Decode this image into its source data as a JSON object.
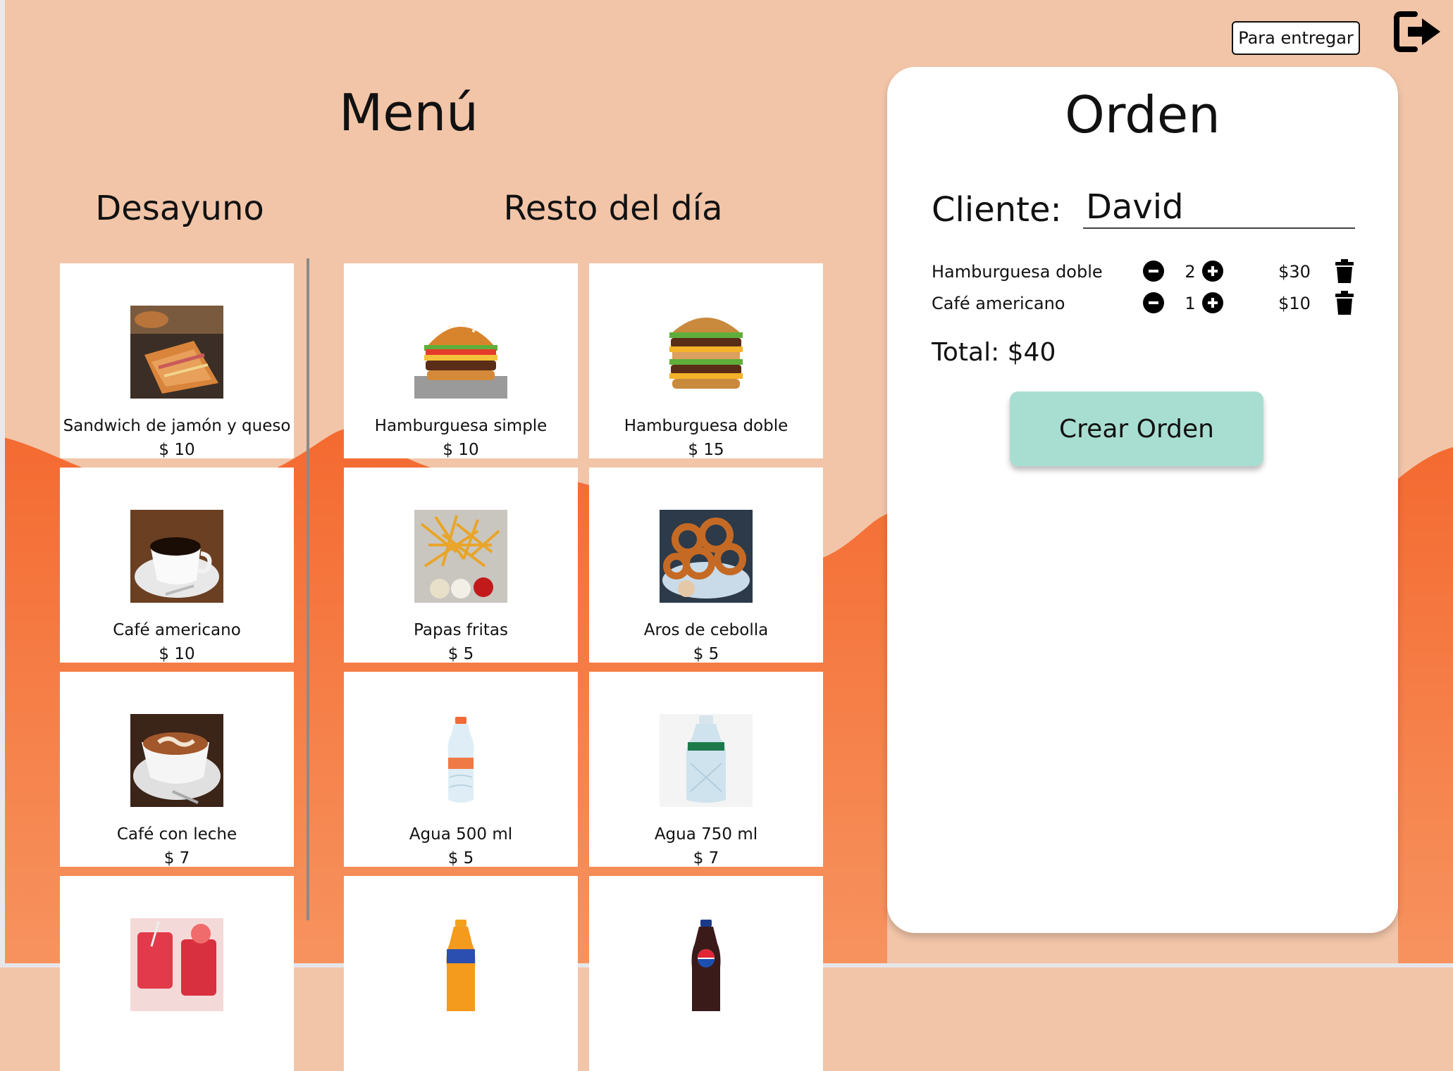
{
  "header": {
    "deliver_button": "Para entregar",
    "exit_icon": "sign-out-icon"
  },
  "menu": {
    "title": "Menú",
    "sections": {
      "breakfast": "Desayuno",
      "rest_of_day": "Resto del día"
    },
    "breakfast_items": [
      {
        "name": "Sandwich de jamón y queso",
        "price": "$ 10",
        "image": "ham-cheese-sandwich"
      },
      {
        "name": "Café americano",
        "price": "$ 10",
        "image": "coffee-cup"
      },
      {
        "name": "Café con leche",
        "price": "$ 7",
        "image": "latte-cup"
      },
      {
        "name": "",
        "price": "",
        "image": "fruit-juice"
      }
    ],
    "day_items": [
      {
        "name": "Hamburguesa simple",
        "price": "$ 10",
        "image": "burger-simple"
      },
      {
        "name": "Hamburguesa doble",
        "price": "$ 15",
        "image": "burger-double"
      },
      {
        "name": "Papas fritas",
        "price": "$ 5",
        "image": "french-fries"
      },
      {
        "name": "Aros de cebolla",
        "price": "$ 5",
        "image": "onion-rings"
      },
      {
        "name": "Agua 500 ml",
        "price": "$ 5",
        "image": "water-bottle-small"
      },
      {
        "name": "Agua 750 ml",
        "price": "$ 7",
        "image": "water-bottle-large"
      },
      {
        "name": "",
        "price": "",
        "image": "fanta-bottle"
      },
      {
        "name": "",
        "price": "",
        "image": "pepsi-bottle"
      }
    ]
  },
  "order": {
    "title": "Orden",
    "client_label": "Cliente:",
    "client_value": "David",
    "items": [
      {
        "name": "Hamburguesa doble",
        "qty": "2",
        "price": "$30"
      },
      {
        "name": "Café americano",
        "qty": "1",
        "price": "$10"
      }
    ],
    "total": "Total: $40",
    "create_button": "Crear Orden"
  },
  "colors": {
    "background_light": "#f2c5a8",
    "background_wave": "#f47a45",
    "button_accent": "#a8ded1",
    "card": "#ffffff"
  }
}
